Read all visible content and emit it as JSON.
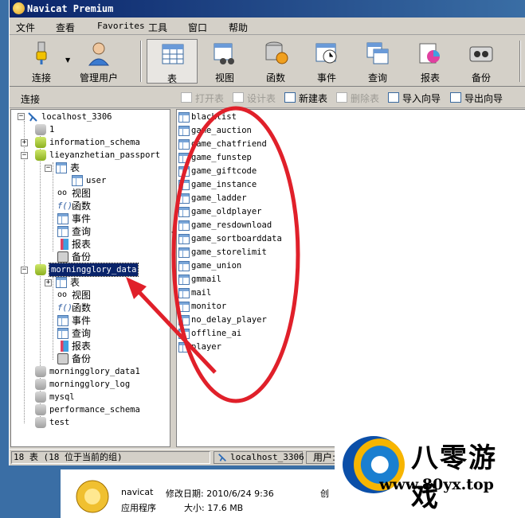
{
  "window": {
    "title": "Navicat Premium"
  },
  "menu": [
    "文件",
    "查看",
    "Favorites",
    "工具",
    "窗口",
    "帮助"
  ],
  "toolbar": {
    "connect": "连接",
    "manage_users": "管理用户",
    "table": "表",
    "view": "视图",
    "function": "函数",
    "event": "事件",
    "query": "查询",
    "report": "报表",
    "backup": "备份"
  },
  "subtoolbar": {
    "caption": "连接",
    "open_table": "打开表",
    "design_table": "设计表",
    "new_table": "新建表",
    "delete_table": "删除表",
    "import_wizard": "导入向导",
    "export_wizard": "导出向导"
  },
  "tree": {
    "connection": "localhost_3306",
    "db_1": "1",
    "db_information_schema": "information_schema",
    "db_lieyan": "lieyanzhetian_passport",
    "lieyan_tables": "表",
    "lieyan_user": "user",
    "lieyan_view": "视图",
    "lieyan_function": "函数",
    "lieyan_event": "事件",
    "lieyan_query": "查询",
    "lieyan_report": "报表",
    "lieyan_backup": "备份",
    "db_morning": "morningglory_data",
    "morning_tables": "表",
    "morning_view": "视图",
    "morning_function": "函数",
    "morning_event": "事件",
    "morning_query": "查询",
    "morning_report": "报表",
    "morning_backup": "备份",
    "db_morning1": "morningglory_data1",
    "db_morning_log": "morningglory_log",
    "db_mysql": "mysql",
    "db_perf": "performance_schema",
    "db_test": "test"
  },
  "tables": [
    "blacklist",
    "game_auction",
    "game_chatfriend",
    "game_funstep",
    "game_giftcode",
    "game_instance",
    "game_ladder",
    "game_oldplayer",
    "game_resdownload",
    "game_sortboarddata",
    "game_storelimit",
    "game_union",
    "gmmail",
    "mail",
    "monitor",
    "no_delay_player",
    "offline_ai",
    "player"
  ],
  "status": {
    "count": "18 表 (18 位于当前的组)",
    "connection": "localhost_3306",
    "user_label": "用户:"
  },
  "explorer": {
    "name": "navicat",
    "modified_label": "修改日期: 2010/6/24 9:36",
    "created_label": "创",
    "type": "应用程序",
    "size_label": "大小: 17.6 MB"
  },
  "watermark": {
    "brand": "八零游戏",
    "url": "www.80yx.top"
  },
  "colors": {
    "annotation": "#e0202a",
    "selection": "#0a246a",
    "titlebar": "#0a246a"
  }
}
